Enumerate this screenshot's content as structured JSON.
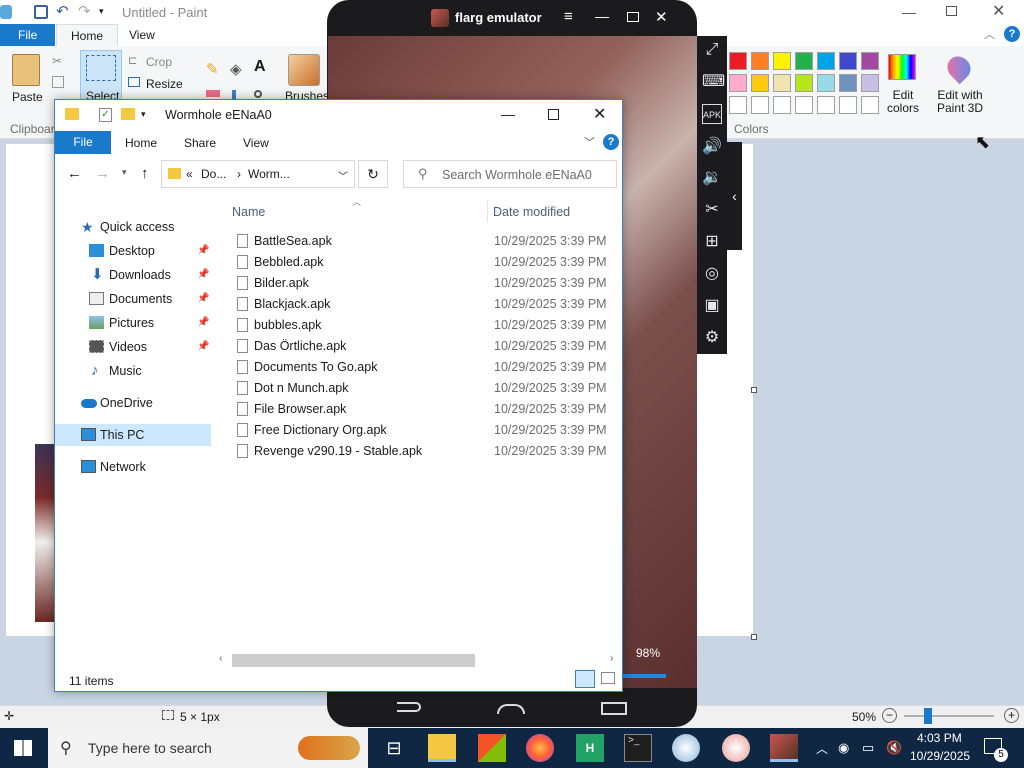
{
  "paint": {
    "title": "Untitled - Paint",
    "tabs": {
      "file": "File",
      "home": "Home",
      "view": "View"
    },
    "ribbon": {
      "paste": "Paste",
      "clipboard": "Clipboard",
      "select": "Select",
      "crop": "Crop",
      "resize": "Resize",
      "brushes": "Brushes",
      "colors": "Colors",
      "edit_colors": "Edit colors",
      "edit_paint3d": "Edit with Paint 3D"
    },
    "status": {
      "size": "5 × 1px",
      "zoom": "50%"
    },
    "swatches_row1": [
      "#ec1c24",
      "#ff7f27",
      "#fff200",
      "#22b14c",
      "#00a2e8",
      "#3f48cc",
      "#a349a4"
    ],
    "swatches_row2": [
      "#ffaec9",
      "#ffc90e",
      "#efe4b0",
      "#b5e61d",
      "#99d9ea",
      "#7092be",
      "#c8bfe7"
    ]
  },
  "explorer": {
    "title": "Wormhole eENaA0",
    "ribbon_tabs": {
      "file": "File",
      "home": "Home",
      "share": "Share",
      "view": "View"
    },
    "breadcrumb": {
      "part1": "Do...",
      "part2": "Worm...",
      "prefix": "«"
    },
    "search_placeholder": "Search Wormhole eENaA0",
    "columns": {
      "name": "Name",
      "date": "Date modified"
    },
    "nav": {
      "quick_access": "Quick access",
      "desktop": "Desktop",
      "downloads": "Downloads",
      "documents": "Documents",
      "pictures": "Pictures",
      "videos": "Videos",
      "music": "Music",
      "onedrive": "OneDrive",
      "this_pc": "This PC",
      "network": "Network"
    },
    "files": [
      {
        "name": "BattleSea.apk",
        "date": "10/29/2025 3:39 PM"
      },
      {
        "name": "Bebbled.apk",
        "date": "10/29/2025 3:39 PM"
      },
      {
        "name": "Bilder.apk",
        "date": "10/29/2025 3:39 PM"
      },
      {
        "name": "Blackjack.apk",
        "date": "10/29/2025 3:39 PM"
      },
      {
        "name": "bubbles.apk",
        "date": "10/29/2025 3:39 PM"
      },
      {
        "name": "Das Örtliche.apk",
        "date": "10/29/2025 3:39 PM"
      },
      {
        "name": "Documents To Go.apk",
        "date": "10/29/2025 3:39 PM"
      },
      {
        "name": "Dot n Munch.apk",
        "date": "10/29/2025 3:39 PM"
      },
      {
        "name": "File Browser.apk",
        "date": "10/29/2025 3:39 PM"
      },
      {
        "name": "Free Dictionary Org.apk",
        "date": "10/29/2025 3:39 PM"
      },
      {
        "name": "Revenge v290.19 - Stable.apk",
        "date": "10/29/2025 3:39 PM"
      }
    ],
    "item_count": "11 items"
  },
  "emulator": {
    "title": "flarg emulator",
    "progress_label": "98%"
  },
  "taskbar": {
    "search_placeholder": "Type here to search",
    "time": "4:03 PM",
    "date": "10/29/2025",
    "notification_count": "5"
  }
}
